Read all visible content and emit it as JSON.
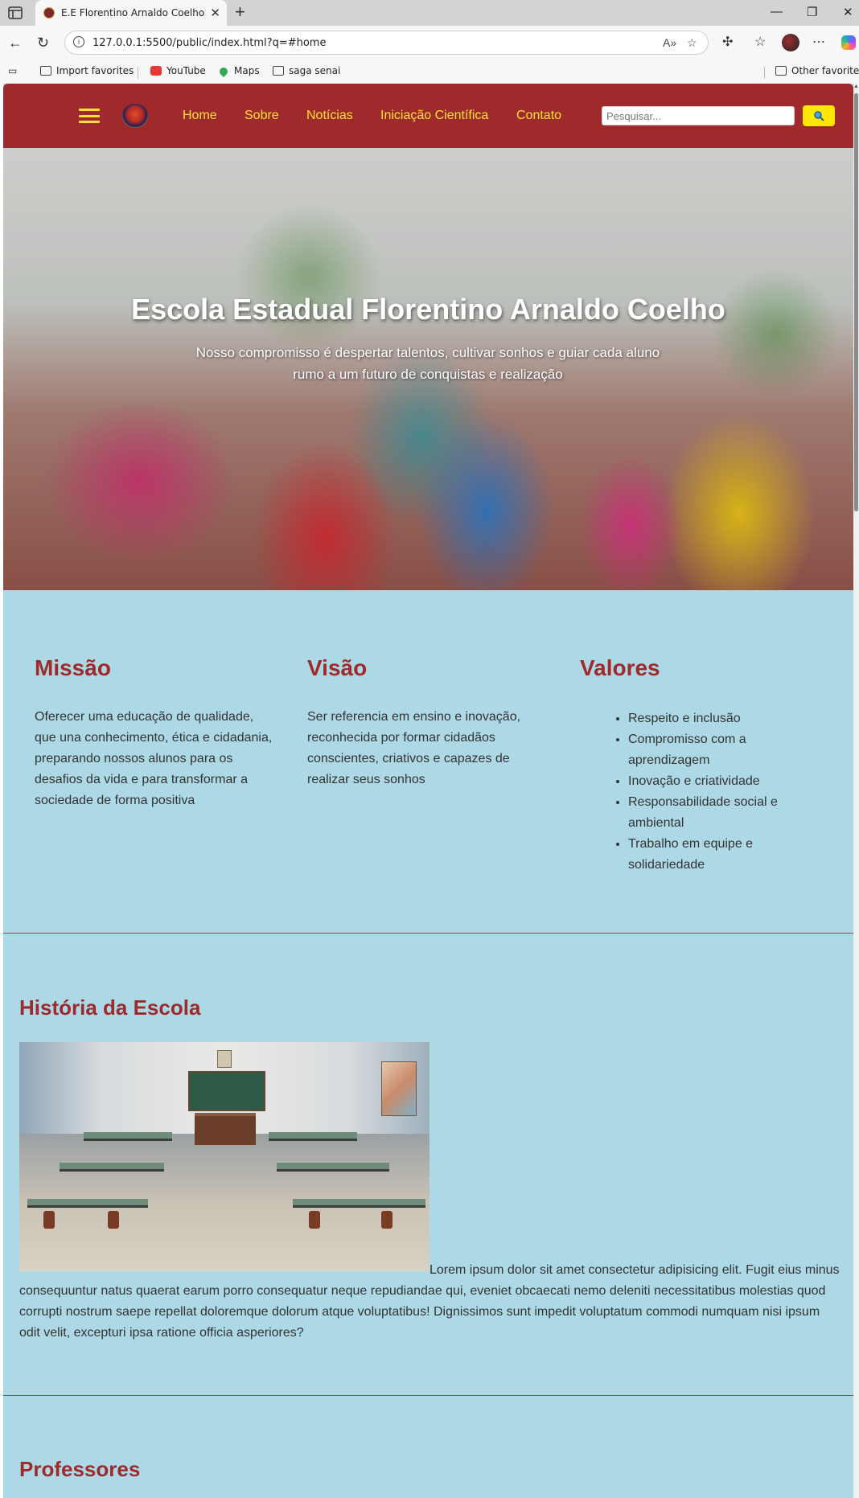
{
  "browser": {
    "tab_title": "E.E Florentino Arnaldo Coelho",
    "url": "127.0.0.1:5500/public/index.html?q=#home",
    "bookmarks": [
      "Import favorites",
      "YouTube",
      "Maps",
      "saga senai"
    ],
    "other_favorites": "Other favorites"
  },
  "header": {
    "nav": [
      "Home",
      "Sobre",
      "Notícias",
      "Iniciação Científica",
      "Contato"
    ],
    "search_placeholder": "Pesquisar...",
    "colors": {
      "header_bg": "#9e2a2b",
      "nav_text": "#ffe135",
      "search_button": "#ffe600"
    }
  },
  "hero": {
    "title": "Escola Estadual Florentino Arnaldo Coelho",
    "subtitle": "Nosso compromisso é despertar talentos, cultivar sonhos e guiar cada aluno rumo a um futuro de conquistas e realização"
  },
  "missao": {
    "title": "Missão",
    "text": "Oferecer uma educação de qualidade, que una conhecimento, ética e cidadania, preparando nossos alunos para os desafios da vida e para transformar a sociedade de forma positiva"
  },
  "visao": {
    "title": "Visão",
    "text": "Ser referencia em ensino e inovação, reconhecida por formar cidadãos conscientes, criativos e capazes de realizar seus sonhos"
  },
  "valores": {
    "title": "Valores",
    "items": [
      "Respeito e inclusão",
      "Compromisso com a aprendizagem",
      "Inovação e criatividade",
      "Responsabilidade social e ambiental",
      "Trabalho em equipe e solidariedade"
    ]
  },
  "historia": {
    "title": "História da Escola",
    "text": "Lorem ipsum dolor sit amet consectetur adipisicing elit. Fugit eius minus consequuntur natus quaerat earum porro consequatur neque repudiandae qui, eveniet obcaecati nemo deleniti necessitatibus molestias quod corrupti nostrum saepe repellat doloremque dolorum atque voluptatibus! Dignissimos sunt impedit voluptatum commodi numquam nisi ipsum odit velit, excepturi ipsa ratione officia asperiores?"
  },
  "professores": {
    "title": "Professores"
  },
  "colors": {
    "page_bg": "#add8e6",
    "accent": "#9e2a2b",
    "divider": "#c0392b"
  }
}
